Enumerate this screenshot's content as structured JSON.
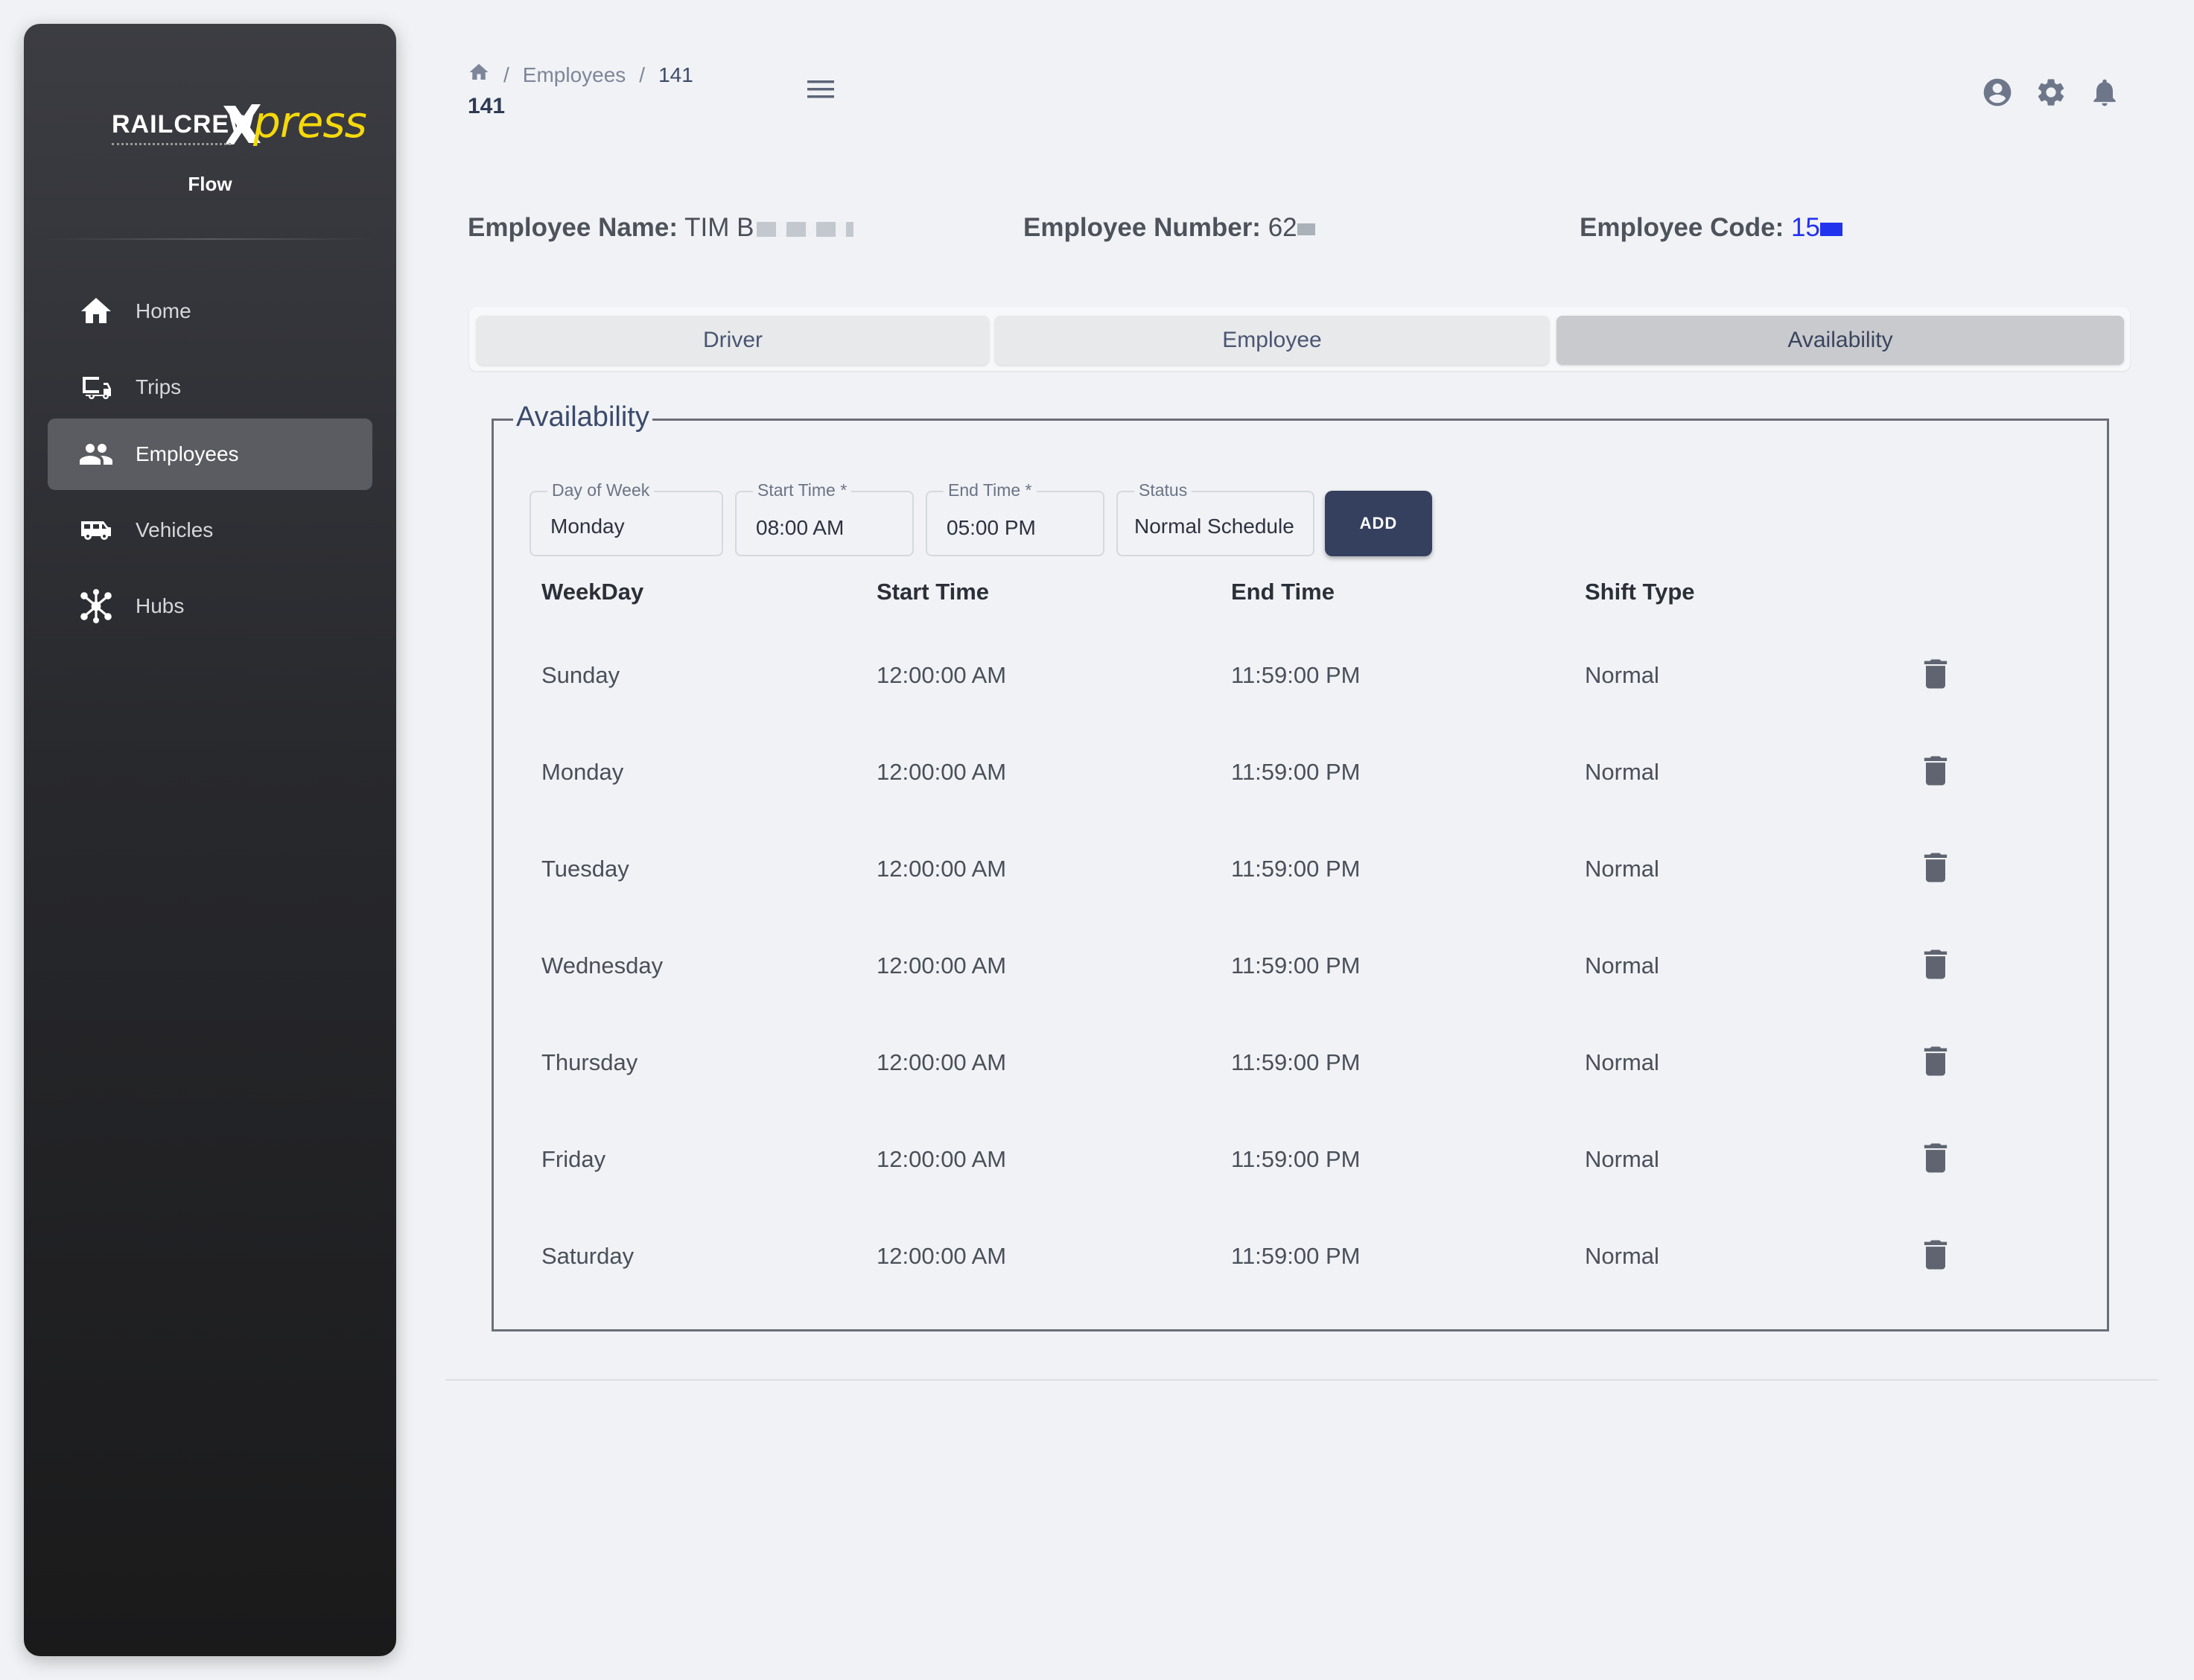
{
  "brand": {
    "name_left": "RAILCREW",
    "name_right": "press",
    "subtitle": "Flow"
  },
  "sidebar": {
    "items": [
      {
        "label": "Home",
        "icon": "home-icon"
      },
      {
        "label": "Trips",
        "icon": "trips-icon"
      },
      {
        "label": "Employees",
        "icon": "employees-icon",
        "active": true
      },
      {
        "label": "Vehicles",
        "icon": "vehicle-icon"
      },
      {
        "label": "Hubs",
        "icon": "hubs-icon"
      }
    ]
  },
  "header": {
    "breadcrumb": [
      "Employees",
      "141"
    ],
    "title": "141"
  },
  "employee": {
    "name_label": "Employee Name:",
    "name_value": "TIM B",
    "number_label": "Employee Number:",
    "number_value": "62",
    "code_label": "Employee Code:",
    "code_value": "15"
  },
  "tabs": [
    "Driver",
    "Employee",
    "Availability"
  ],
  "active_tab": "Availability",
  "availability": {
    "legend": "Availability",
    "form": {
      "day_label": "Day of Week",
      "day_value": "Monday",
      "start_label": "Start Time *",
      "start_value": "08:00 AM",
      "end_label": "End Time *",
      "end_value": "05:00 PM",
      "status_label": "Status",
      "status_value": "Normal Schedule",
      "add_label": "ADD"
    },
    "columns": [
      "WeekDay",
      "Start Time",
      "End Time",
      "Shift Type"
    ],
    "rows": [
      {
        "day": "Sunday",
        "start": "12:00:00 AM",
        "end": "11:59:00 PM",
        "type": "Normal"
      },
      {
        "day": "Monday",
        "start": "12:00:00 AM",
        "end": "11:59:00 PM",
        "type": "Normal"
      },
      {
        "day": "Tuesday",
        "start": "12:00:00 AM",
        "end": "11:59:00 PM",
        "type": "Normal"
      },
      {
        "day": "Wednesday",
        "start": "12:00:00 AM",
        "end": "11:59:00 PM",
        "type": "Normal"
      },
      {
        "day": "Thursday",
        "start": "12:00:00 AM",
        "end": "11:59:00 PM",
        "type": "Normal"
      },
      {
        "day": "Friday",
        "start": "12:00:00 AM",
        "end": "11:59:00 PM",
        "type": "Normal"
      },
      {
        "day": "Saturday",
        "start": "12:00:00 AM",
        "end": "11:59:00 PM",
        "type": "Normal"
      }
    ]
  },
  "colors": {
    "accent": "#34405e",
    "code_link": "#2233ee",
    "logo_yellow": "#f5d90a"
  }
}
